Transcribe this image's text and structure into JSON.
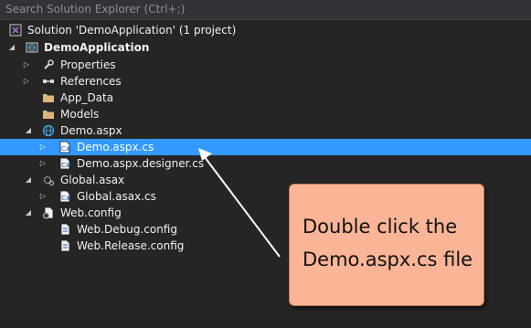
{
  "search": {
    "placeholder": "Search Solution Explorer (Ctrl+;)"
  },
  "tree": {
    "solution_label": "Solution 'DemoApplication' (1 project)",
    "project_label": "DemoApplication",
    "properties_label": "Properties",
    "references_label": "References",
    "app_data_label": "App_Data",
    "models_label": "Models",
    "demo_aspx_label": "Demo.aspx",
    "demo_aspx_cs_label": "Demo.aspx.cs",
    "demo_designer_label": "Demo.aspx.designer.cs",
    "global_asax_label": "Global.asax",
    "global_asax_cs_label": "Global.asax.cs",
    "web_config_label": "Web.config",
    "web_debug_label": "Web.Debug.config",
    "web_release_label": "Web.Release.config",
    "selected_item": "Demo.aspx.cs"
  },
  "callout": {
    "text": "Double click the\nDemo.aspx.cs file",
    "color": "#f9b596"
  },
  "colors": {
    "background": "#252526",
    "selection": "#3399ff",
    "text": "#f1f1f1"
  }
}
